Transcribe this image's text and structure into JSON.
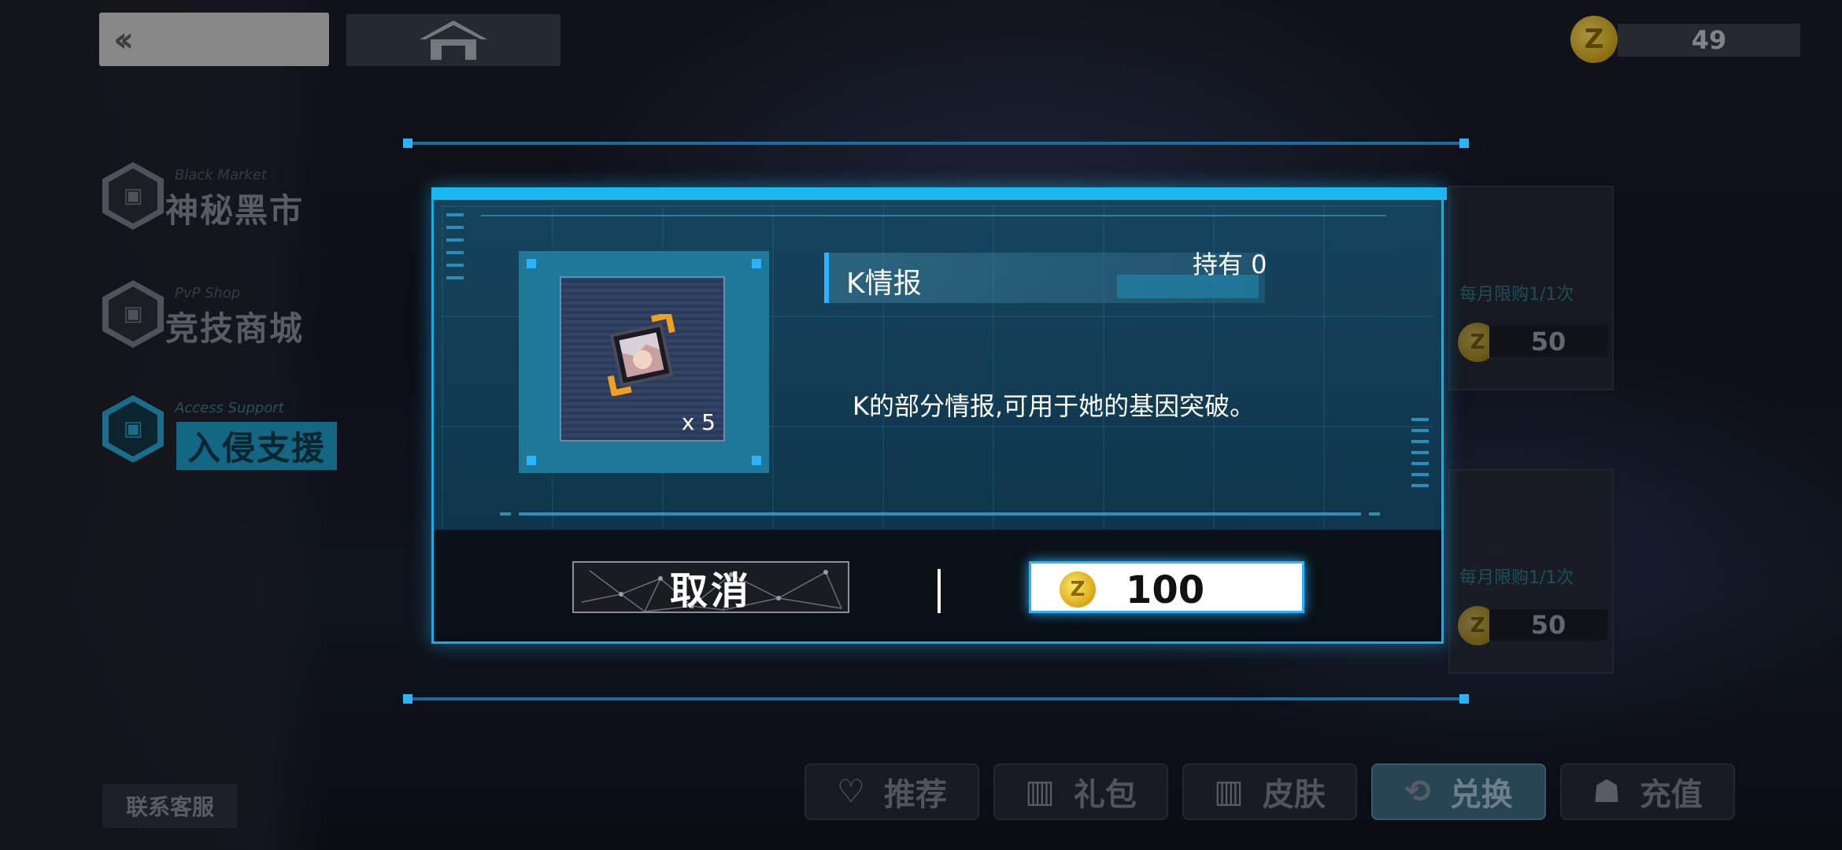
{
  "top_bar": {
    "back_icon": "double-chevron-left-icon",
    "home_icon": "home-icon",
    "currency_amount": "49"
  },
  "sidebar": {
    "items": [
      {
        "en": "Black Market",
        "cn": "神秘黑市",
        "active": false
      },
      {
        "en": "PvP Shop",
        "cn": "竞技商城",
        "active": false
      },
      {
        "en": "Access Support",
        "cn": "入侵支援",
        "active": true
      }
    ],
    "service_label": "联系客服"
  },
  "bottom_tabs": [
    {
      "label": "推荐",
      "icon": "heart-check-icon",
      "active": false
    },
    {
      "label": "礼包",
      "icon": "gift-icon",
      "active": false
    },
    {
      "label": "皮肤",
      "icon": "gift-icon",
      "active": false
    },
    {
      "label": "兑换",
      "icon": "exchange-icon",
      "active": true
    },
    {
      "label": "充值",
      "icon": "people-icon",
      "active": false
    }
  ],
  "background_cards": [
    {
      "limit_text": "每月限购1/1次",
      "price": "50"
    },
    {
      "limit_text": "每月限购1/1次",
      "price": "50"
    }
  ],
  "dialog": {
    "item_name": "K情报",
    "owned_text": "持有 0",
    "quantity": "x 5",
    "description": "K的部分情报,可用于她的基因突破。",
    "cancel_label": "取消",
    "confirm_price": "100"
  },
  "colors": {
    "accent": "#19b8f0",
    "dialog_bg": "#164660",
    "coin": "#e0b020"
  }
}
